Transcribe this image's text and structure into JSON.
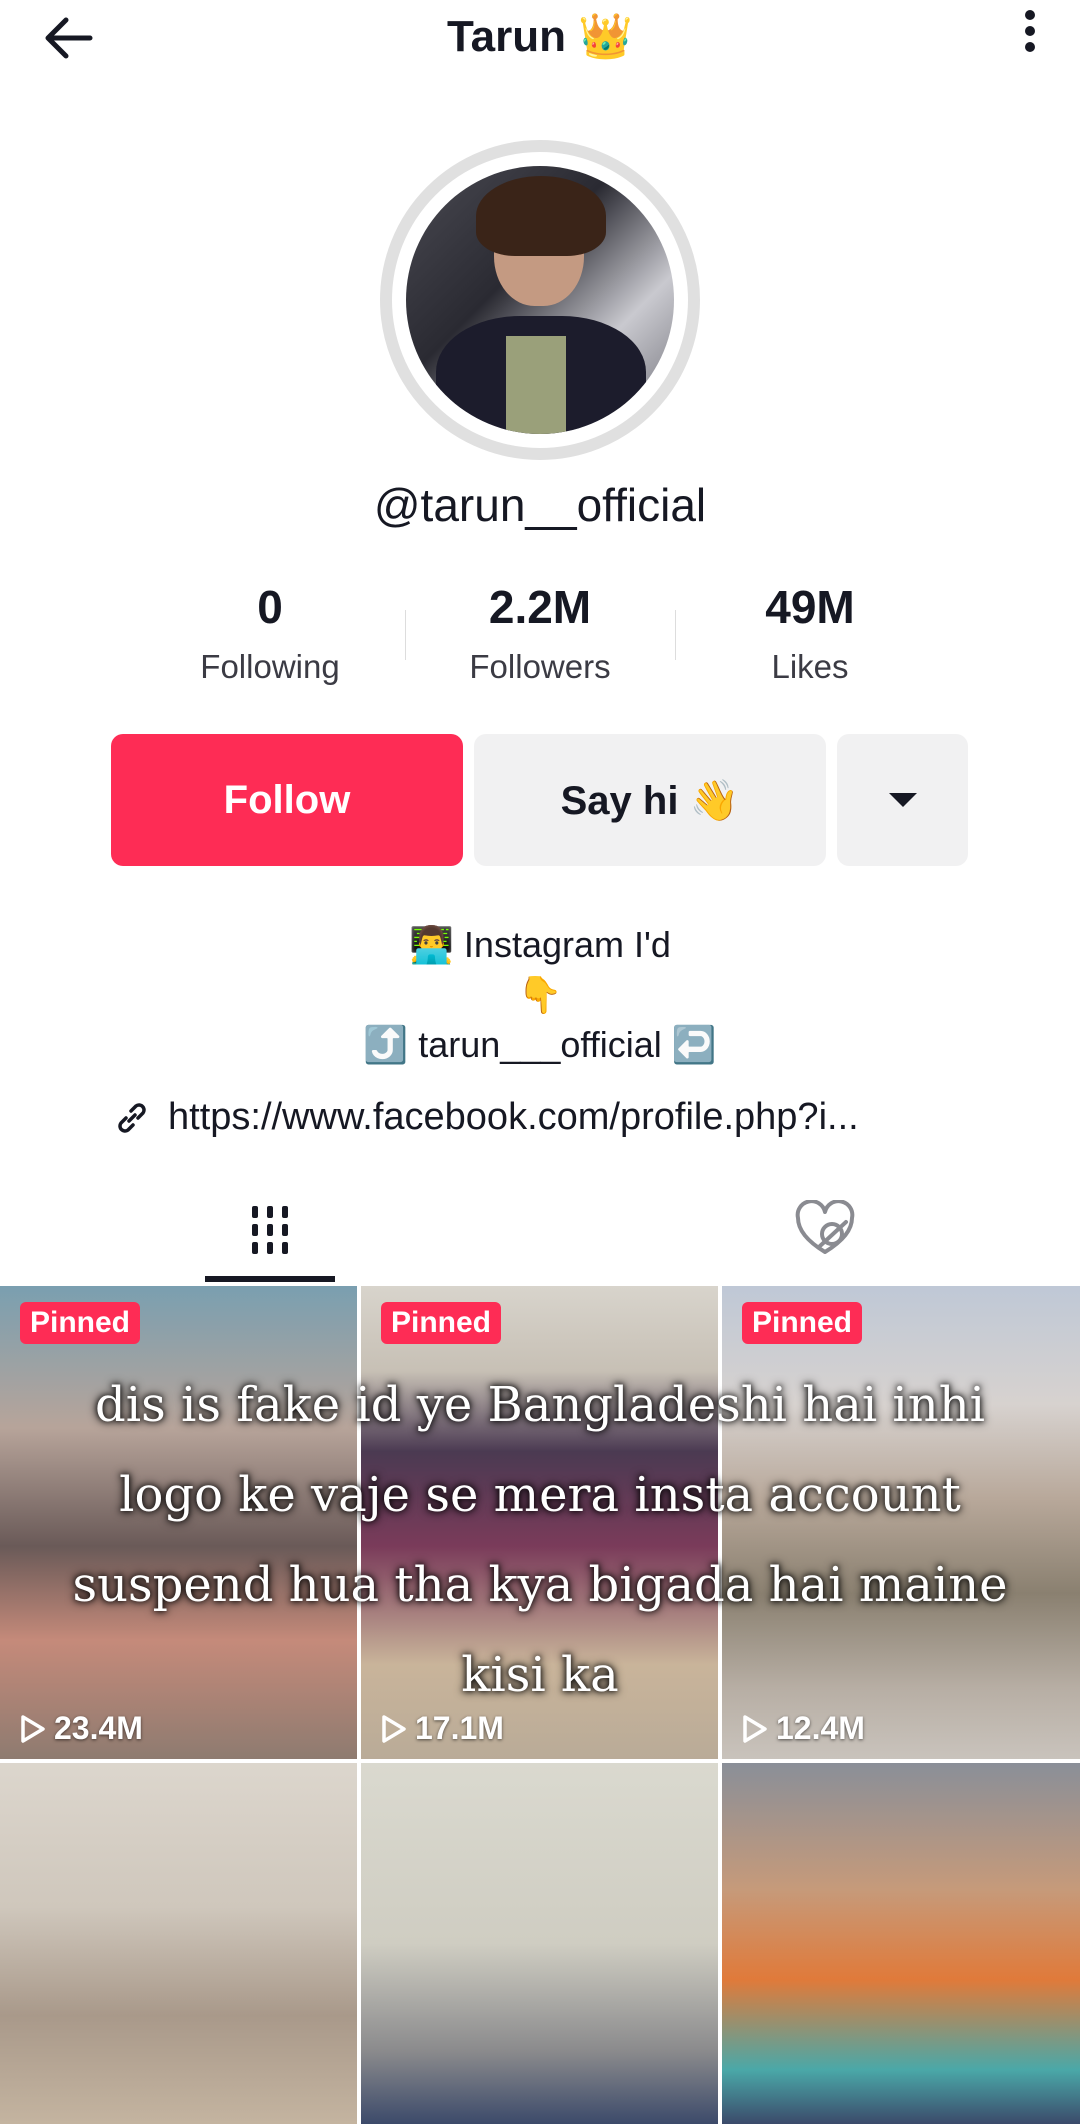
{
  "header": {
    "title": "Tarun 👑"
  },
  "profile": {
    "username": "@tarun__official"
  },
  "stats": [
    {
      "value": "0",
      "label": "Following"
    },
    {
      "value": "2.2M",
      "label": "Followers"
    },
    {
      "value": "49M",
      "label": "Likes"
    }
  ],
  "actions": {
    "follow": "Follow",
    "say_hi": "Say hi 👋"
  },
  "bio": {
    "line1": "👨‍💻 Instagram I'd",
    "line2": "👇",
    "line3": "⤴️ tarun___official ↩️",
    "link": "https://www.facebook.com/profile.php?i..."
  },
  "videos": [
    {
      "pinned": "Pinned",
      "views": "23.4M"
    },
    {
      "pinned": "Pinned",
      "views": "17.1M"
    },
    {
      "pinned": "Pinned",
      "views": "12.4M"
    },
    {
      "views": ""
    },
    {
      "views": ""
    },
    {
      "views": ""
    }
  ],
  "overlay_caption": "dis is fake id ye Bangladeshi hai inhi logo ke vaje se mera insta account suspend hua tha kya bigada hai maine kisi ka",
  "colors": {
    "accent": "#fe2c55",
    "secondary_button": "#f1f1f2"
  }
}
